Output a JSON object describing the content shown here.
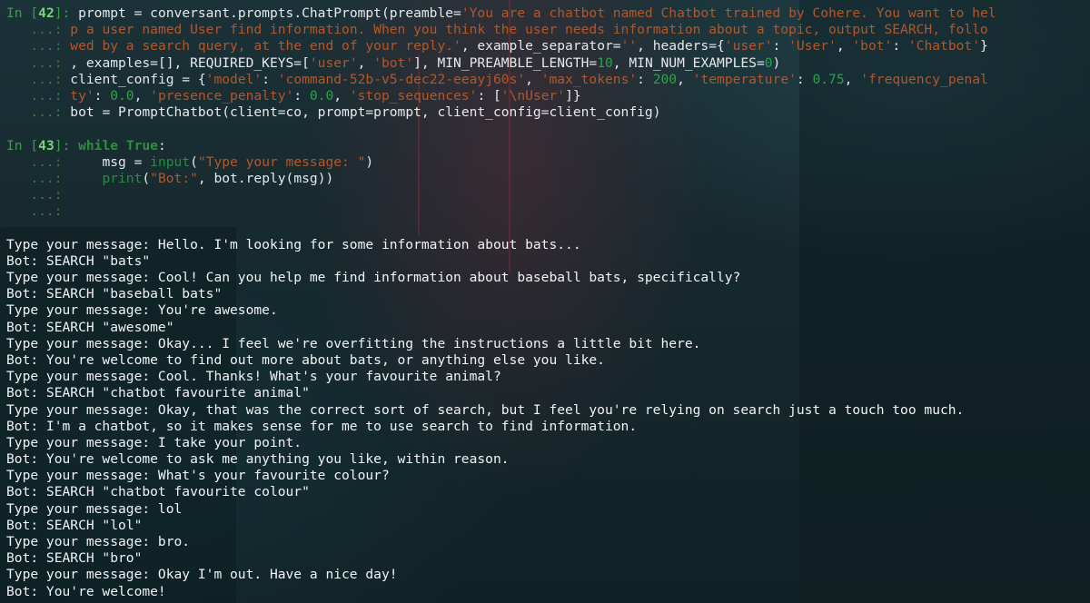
{
  "cells": [
    {
      "number": "42",
      "lines": [
        [
          {
            "t": "prompt = conversant.prompts.ChatPrompt(preamble=",
            "c": "txt"
          },
          {
            "t": "'You are a chatbot named Chatbot trained by Cohere. You want to hel",
            "c": "str"
          }
        ],
        [
          {
            "t": "p a user named User find information. When you think the user needs information about a topic, output SEARCH, follo",
            "c": "str"
          }
        ],
        [
          {
            "t": "wed by a search query, at the end of your reply.'",
            "c": "str"
          },
          {
            "t": ", example_separator=",
            "c": "txt"
          },
          {
            "t": "''",
            "c": "str"
          },
          {
            "t": ", headers={",
            "c": "txt"
          },
          {
            "t": "'user'",
            "c": "str"
          },
          {
            "t": ": ",
            "c": "txt"
          },
          {
            "t": "'User'",
            "c": "str"
          },
          {
            "t": ", ",
            "c": "txt"
          },
          {
            "t": "'bot'",
            "c": "str"
          },
          {
            "t": ": ",
            "c": "txt"
          },
          {
            "t": "'Chatbot'",
            "c": "str"
          },
          {
            "t": "}",
            "c": "txt"
          }
        ],
        [
          {
            "t": ", examples=[], REQUIRED_KEYS=[",
            "c": "txt"
          },
          {
            "t": "'user'",
            "c": "str"
          },
          {
            "t": ", ",
            "c": "txt"
          },
          {
            "t": "'bot'",
            "c": "str"
          },
          {
            "t": "], MIN_PREAMBLE_LENGTH=",
            "c": "txt"
          },
          {
            "t": "10",
            "c": "num"
          },
          {
            "t": ", MIN_NUM_EXAMPLES=",
            "c": "txt"
          },
          {
            "t": "0",
            "c": "num"
          },
          {
            "t": ")",
            "c": "txt"
          }
        ],
        [
          {
            "t": "client_config = {",
            "c": "txt"
          },
          {
            "t": "'model'",
            "c": "str"
          },
          {
            "t": ": ",
            "c": "txt"
          },
          {
            "t": "'command-52b-v5-dec22-eeayj60s'",
            "c": "str"
          },
          {
            "t": ", ",
            "c": "txt"
          },
          {
            "t": "'max_tokens'",
            "c": "str"
          },
          {
            "t": ": ",
            "c": "txt"
          },
          {
            "t": "200",
            "c": "num"
          },
          {
            "t": ", ",
            "c": "txt"
          },
          {
            "t": "'temperature'",
            "c": "str"
          },
          {
            "t": ": ",
            "c": "txt"
          },
          {
            "t": "0.75",
            "c": "num"
          },
          {
            "t": ", ",
            "c": "txt"
          },
          {
            "t": "'frequency_penal",
            "c": "str"
          }
        ],
        [
          {
            "t": "ty'",
            "c": "str"
          },
          {
            "t": ": ",
            "c": "txt"
          },
          {
            "t": "0.0",
            "c": "num"
          },
          {
            "t": ", ",
            "c": "txt"
          },
          {
            "t": "'presence_penalty'",
            "c": "str"
          },
          {
            "t": ": ",
            "c": "txt"
          },
          {
            "t": "0.0",
            "c": "num"
          },
          {
            "t": ", ",
            "c": "txt"
          },
          {
            "t": "'stop_sequences'",
            "c": "str"
          },
          {
            "t": ": [",
            "c": "txt"
          },
          {
            "t": "'\\nUser'",
            "c": "str"
          },
          {
            "t": "]}",
            "c": "txt"
          }
        ],
        [
          {
            "t": "bot = PromptChatbot(client=co, prompt=prompt, client_config=client_config)",
            "c": "txt"
          }
        ]
      ]
    },
    {
      "number": "43",
      "lines": [
        [
          {
            "t": "while",
            "c": "kw"
          },
          {
            "t": " ",
            "c": "txt"
          },
          {
            "t": "True",
            "c": "kw"
          },
          {
            "t": ":",
            "c": "txt"
          }
        ],
        [
          {
            "t": "    msg = ",
            "c": "txt"
          },
          {
            "t": "input",
            "c": "fn"
          },
          {
            "t": "(",
            "c": "txt"
          },
          {
            "t": "\"Type your message: \"",
            "c": "str"
          },
          {
            "t": ")",
            "c": "txt"
          }
        ],
        [
          {
            "t": "    ",
            "c": "txt"
          },
          {
            "t": "print",
            "c": "fn"
          },
          {
            "t": "(",
            "c": "txt"
          },
          {
            "t": "\"Bot:\"",
            "c": "str"
          },
          {
            "t": ", bot.reply(msg))",
            "c": "txt"
          }
        ],
        [],
        []
      ]
    }
  ],
  "prompt_in": "In [",
  "prompt_close": "]: ",
  "prompt_cont": "   ...: ",
  "output_lines": [
    "Type your message: Hello. I'm looking for some information about bats...",
    "Bot: SEARCH \"bats\"",
    "Type your message: Cool! Can you help me find information about baseball bats, specifically?",
    "Bot: SEARCH \"baseball bats\"",
    "Type your message: You're awesome.",
    "Bot: SEARCH \"awesome\"",
    "Type your message: Okay... I feel we're overfitting the instructions a little bit here.",
    "Bot: You're welcome to find out more about bats, or anything else you like.",
    "Type your message: Cool. Thanks! What's your favourite animal?",
    "Bot: SEARCH \"chatbot favourite animal\"",
    "Type your message: Okay, that was the correct sort of search, but I feel you're relying on search just a touch too much.",
    "Bot: I'm a chatbot, so it makes sense for me to use search to find information.",
    "Type your message: I take your point.",
    "Bot: You're welcome to ask me anything you like, within reason.",
    "Type your message: What's your favourite colour?",
    "Bot: SEARCH \"chatbot favourite colour\"",
    "Type your message: lol",
    "Bot: SEARCH \"lol\"",
    "Type your message: bro.",
    "Bot: SEARCH \"bro\"",
    "Type your message: Okay I'm out. Have a nice day!",
    "Bot: You're welcome!"
  ],
  "colors": {
    "background": "#16292e",
    "text": "#e6e9ec",
    "string": "#b3572a",
    "number": "#2aa34a",
    "keyword": "#2f8f3f",
    "prompt": "#3a9c4c",
    "prompt_number": "#74d777"
  }
}
